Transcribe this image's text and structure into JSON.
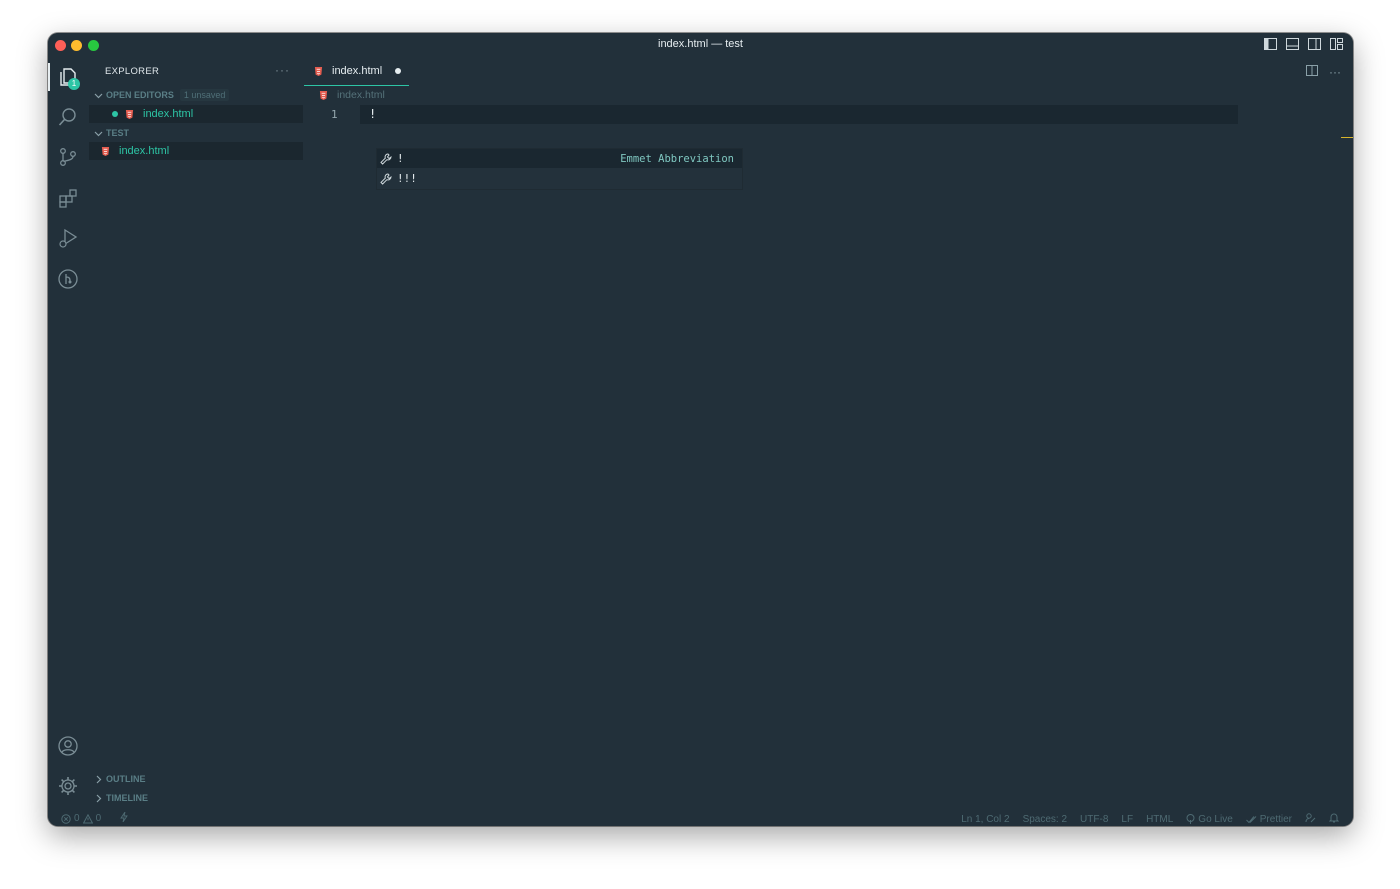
{
  "window": {
    "title": "index.html — test"
  },
  "activity_bar": {
    "explorer_badge": "1"
  },
  "sidebar": {
    "title": "EXPLORER",
    "more": "···",
    "open_editors": {
      "label": "OPEN EDITORS",
      "badge": "1 unsaved",
      "file": "index.html"
    },
    "folder": {
      "label": "TEST",
      "file": "index.html"
    },
    "outline": "OUTLINE",
    "timeline": "TIMELINE"
  },
  "editor": {
    "tab_label": "index.html",
    "breadcrumb": "index.html",
    "line_number": "1",
    "code": "!",
    "more": "···"
  },
  "suggest": {
    "items": [
      {
        "label": "!",
        "detail": "Emmet Abbreviation"
      },
      {
        "label": "!!!",
        "detail": ""
      }
    ]
  },
  "status": {
    "errors": "0",
    "warnings": "0",
    "position": "Ln 1, Col 2",
    "spaces": "Spaces: 2",
    "encoding": "UTF-8",
    "eol": "LF",
    "language": "HTML",
    "go_live": "Go Live",
    "prettier": "Prettier"
  },
  "colors": {
    "background": "#22303a",
    "accent": "#2dc5a5",
    "html_icon": "#e45c4f",
    "line_highlight": "#1a2730"
  }
}
